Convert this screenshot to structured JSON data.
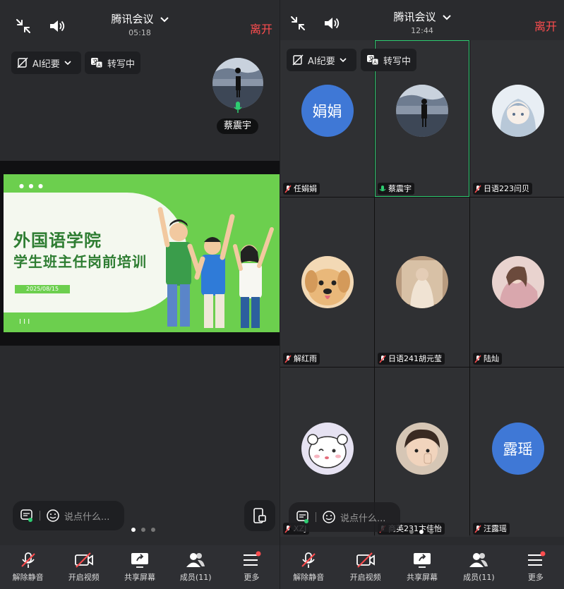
{
  "left": {
    "title": "腾讯会议",
    "time": "05:18",
    "leave": "离开",
    "ai_chip": "AI纪要",
    "transcribe_chip": "转写中",
    "speaker_name": "蔡震宇",
    "slide": {
      "title_line1": "外国语学院",
      "title_line2": "学生班主任岗前培训",
      "date": "2025/08/15"
    },
    "chat_placeholder": "说点什么..."
  },
  "right": {
    "title": "腾讯会议",
    "time": "12:44",
    "leave": "离开",
    "ai_chip": "AI纪要",
    "transcribe_chip": "转写中",
    "chat_placeholder": "说点什么...",
    "tiles": [
      {
        "name": "任娟娟",
        "avatar_text": "娟娟"
      },
      {
        "name": "蔡震宇"
      },
      {
        "name": "日语223闫贝"
      },
      {
        "name": "解红雨"
      },
      {
        "name": "日语241胡元莹"
      },
      {
        "name": "陆灿"
      },
      {
        "name": "XZJ"
      },
      {
        "name": "商英231卞佳怡"
      },
      {
        "name": "汪露瑶",
        "avatar_text": "露瑶"
      }
    ]
  },
  "toolbar": {
    "unmute": "解除静音",
    "video": "开启视频",
    "share": "共享屏幕",
    "members": "成员(11)",
    "more": "更多"
  },
  "colors": {
    "accent_green": "#2ecc71",
    "leave_red": "#ff4d4f",
    "avatar_blue": "#3f78d6",
    "slide_green": "#6ccf4e"
  }
}
